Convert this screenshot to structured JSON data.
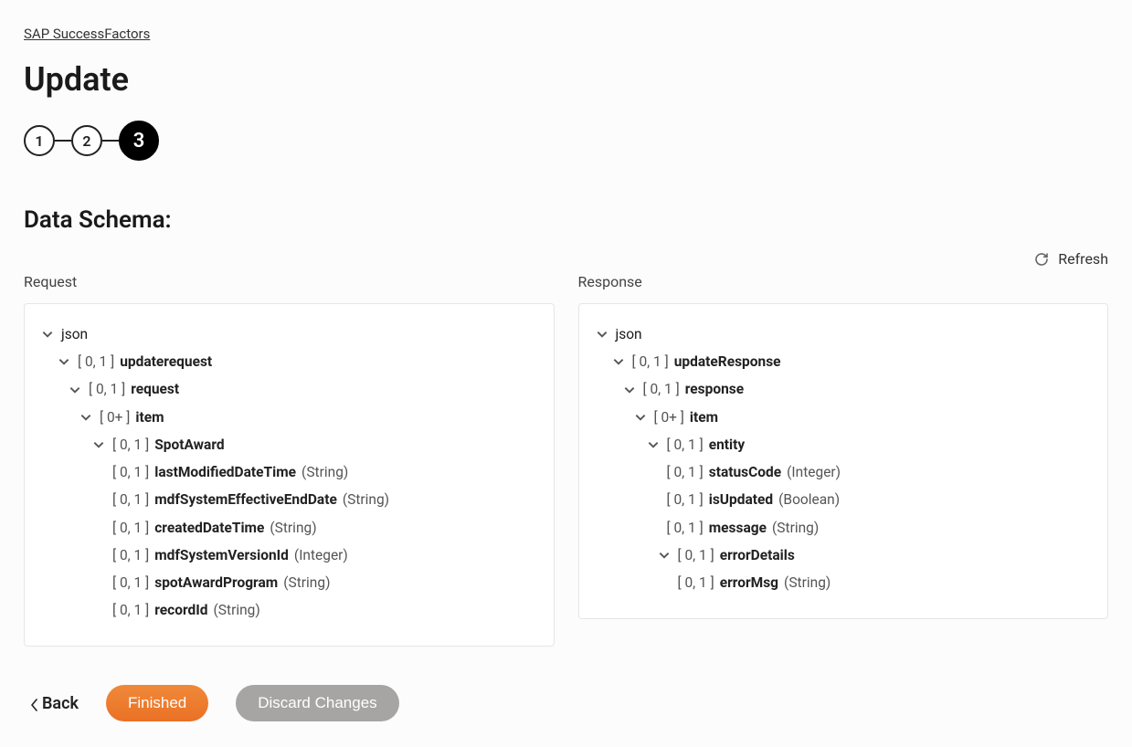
{
  "breadcrumb": "SAP SuccessFactors",
  "pageTitle": "Update",
  "stepper": {
    "s1": "1",
    "s2": "2",
    "s3": "3"
  },
  "sectionTitle": "Data Schema:",
  "refreshLabel": "Refresh",
  "requestHeading": "Request",
  "responseHeading": "Response",
  "request": {
    "root": "json",
    "n1": {
      "card": "[ 0, 1 ]",
      "name": "updaterequest"
    },
    "n2": {
      "card": "[ 0, 1 ]",
      "name": "request"
    },
    "n3": {
      "card": "[ 0+ ]",
      "name": "item"
    },
    "n4": {
      "card": "[ 0, 1 ]",
      "name": "SpotAward"
    },
    "f1": {
      "card": "[ 0, 1 ]",
      "name": "lastModifiedDateTime",
      "type": "(String)"
    },
    "f2": {
      "card": "[ 0, 1 ]",
      "name": "mdfSystemEffectiveEndDate",
      "type": "(String)"
    },
    "f3": {
      "card": "[ 0, 1 ]",
      "name": "createdDateTime",
      "type": "(String)"
    },
    "f4": {
      "card": "[ 0, 1 ]",
      "name": "mdfSystemVersionId",
      "type": "(Integer)"
    },
    "f5": {
      "card": "[ 0, 1 ]",
      "name": "spotAwardProgram",
      "type": "(String)"
    },
    "f6": {
      "card": "[ 0, 1 ]",
      "name": "recordId",
      "type": "(String)"
    }
  },
  "response": {
    "root": "json",
    "n1": {
      "card": "[ 0, 1 ]",
      "name": "updateResponse"
    },
    "n2": {
      "card": "[ 0, 1 ]",
      "name": "response"
    },
    "n3": {
      "card": "[ 0+ ]",
      "name": "item"
    },
    "n4": {
      "card": "[ 0, 1 ]",
      "name": "entity"
    },
    "f1": {
      "card": "[ 0, 1 ]",
      "name": "statusCode",
      "type": "(Integer)"
    },
    "f2": {
      "card": "[ 0, 1 ]",
      "name": "isUpdated",
      "type": "(Boolean)"
    },
    "f3": {
      "card": "[ 0, 1 ]",
      "name": "message",
      "type": "(String)"
    },
    "n5": {
      "card": "[ 0, 1 ]",
      "name": "errorDetails"
    },
    "f4": {
      "card": "[ 0, 1 ]",
      "name": "errorMsg",
      "type": "(String)"
    }
  },
  "footer": {
    "back": "Back",
    "finished": "Finished",
    "discard": "Discard Changes"
  }
}
